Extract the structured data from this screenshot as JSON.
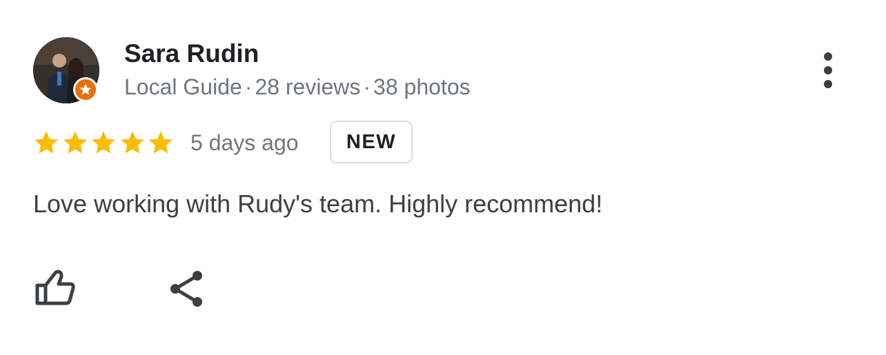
{
  "reviewer": {
    "name": "Sara Rudin",
    "badge_icon": "local-guide-star-icon",
    "meta": {
      "level": "Local Guide",
      "separator": "·",
      "reviews": "28 reviews",
      "photos": "38 photos"
    }
  },
  "menu": {
    "icon": "more-vert-icon"
  },
  "rating": {
    "stars": 5,
    "max": 5,
    "star_color": "#fbbc04",
    "date": "5 days ago",
    "badge": "NEW"
  },
  "review": {
    "text": "Love working with Rudy's team. Highly recommend!"
  },
  "actions": [
    {
      "name": "like",
      "icon": "thumbs-up-icon"
    },
    {
      "name": "share",
      "icon": "share-icon"
    }
  ],
  "colors": {
    "name": "#202124",
    "meta": "#70757a",
    "body": "#3c4043",
    "guide_badge": "#e8710a"
  }
}
